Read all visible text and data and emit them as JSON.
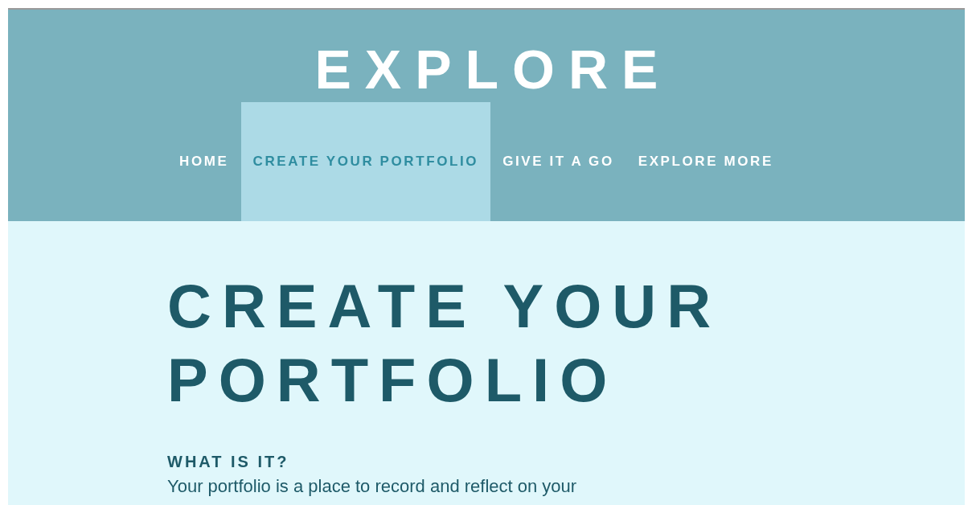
{
  "site_title": "EXPLORE",
  "nav": [
    {
      "label": "HOME",
      "selected": false
    },
    {
      "label": "CREATE YOUR PORTFOLIO",
      "selected": true
    },
    {
      "label": "GIVE IT A GO",
      "selected": false
    },
    {
      "label": "EXPLORE MORE",
      "selected": false
    }
  ],
  "page": {
    "heading": "CREATE YOUR PORTFOLIO",
    "subheading": "WHAT IS IT?",
    "paragraph": "Your portfolio is a place to record and reflect on your"
  }
}
